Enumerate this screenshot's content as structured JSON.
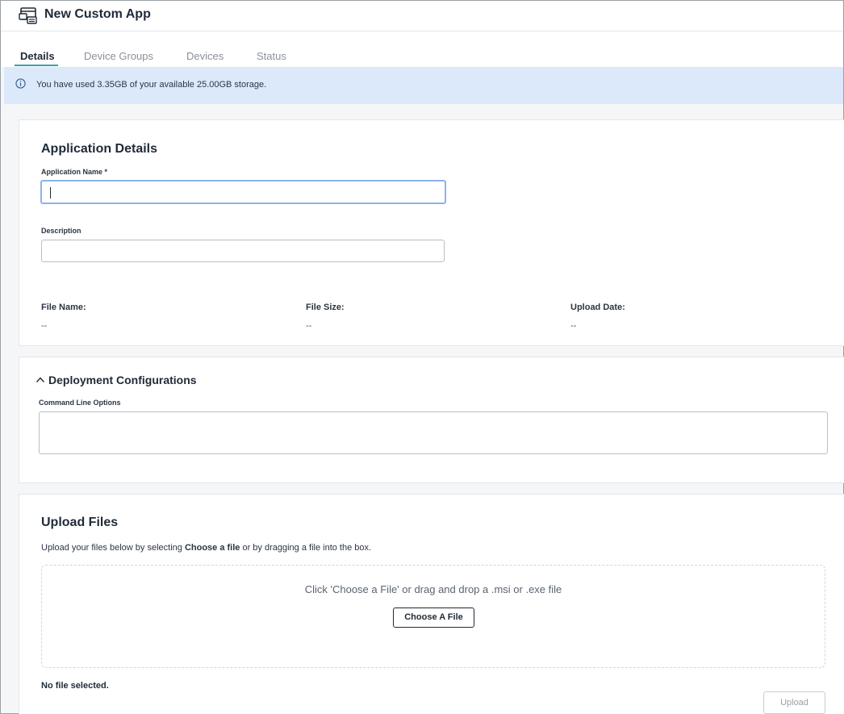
{
  "header": {
    "title": "New Custom App",
    "icon": "app-window-icon"
  },
  "tabs": [
    {
      "label": "Details",
      "active": true
    },
    {
      "label": "Device Groups",
      "active": false
    },
    {
      "label": "Devices",
      "active": false
    },
    {
      "label": "Status",
      "active": false
    }
  ],
  "banner": {
    "icon": "info-icon",
    "text": "You have used 3.35GB of your available 25.00GB storage."
  },
  "app_details": {
    "title": "Application Details",
    "name_label": "Application Name *",
    "name_value": "",
    "description_label": "Description",
    "description_value": "",
    "file_name_label": "File Name:",
    "file_name_value": "--",
    "file_size_label": "File Size:",
    "file_size_value": "--",
    "upload_date_label": "Upload Date:",
    "upload_date_value": "--"
  },
  "deployment": {
    "title": "Deployment Configurations",
    "expanded": true,
    "command_line_label": "Command Line Options",
    "command_line_value": ""
  },
  "upload": {
    "title": "Upload Files",
    "description_prefix": "Upload your files below by selecting ",
    "description_bold": "Choose a file",
    "description_suffix": " or by dragging a file into the box.",
    "dropzone_text": "Click 'Choose a File' or drag and drop a .msi or .exe file",
    "choose_button": "Choose A File",
    "no_file_text": "No file selected.",
    "upload_button": "Upload"
  },
  "colors": {
    "accent": "#3aa0a9",
    "banner_bg": "#dce9fb",
    "focus_border": "#8db3ee"
  }
}
